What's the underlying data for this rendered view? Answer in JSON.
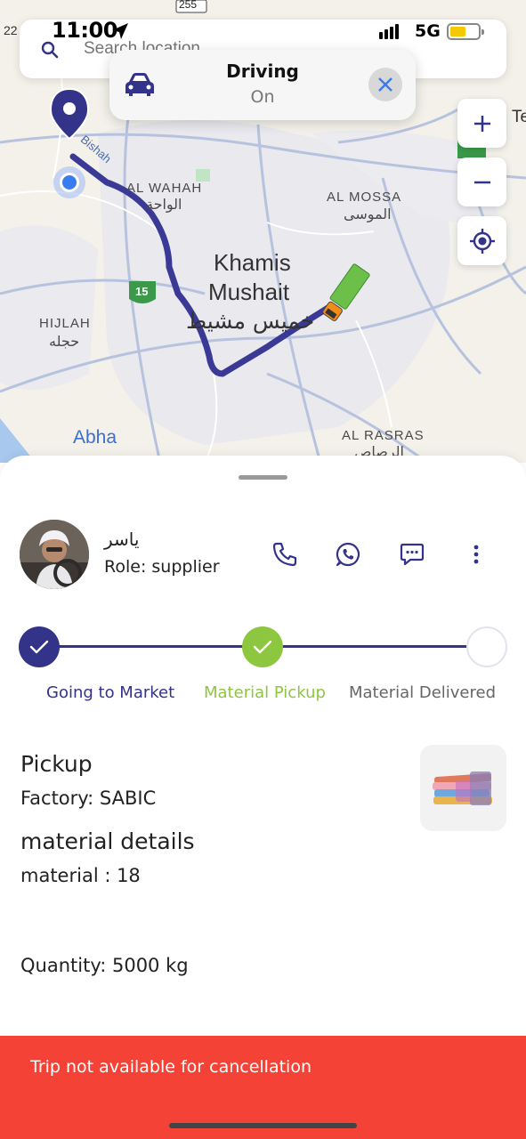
{
  "status_bar": {
    "time": "11:00",
    "network": "5G"
  },
  "search": {
    "placeholder": "Search location"
  },
  "driving": {
    "title": "Driving",
    "status": "On"
  },
  "map": {
    "labels": {
      "al_wahah_en": "AL WAHAH",
      "al_wahah_ar": "الواحة",
      "al_mossa_en": "AL MOSSA",
      "al_mossa_ar": "الموسى",
      "khamis_1": "Khamis",
      "khamis_2": "Mushait",
      "khamis_ar": "خميس مشيط",
      "hijlah_en": "HIJLAH",
      "hijlah_ar": "حجله",
      "abha": "Abha",
      "al_rasras_en": "AL RASRAS",
      "al_rasras_ar": "الرصاص",
      "road_bishah": "Bishah",
      "route_15": "15",
      "route_255": "255",
      "edge_te": "Te",
      "edge_22": "22"
    },
    "route_color": "#3a3a96"
  },
  "driver": {
    "name": "ياسر",
    "role": "Role: supplier"
  },
  "steps": [
    {
      "label": "Going to Market",
      "state": "done"
    },
    {
      "label": "Material Pickup",
      "state": "current"
    },
    {
      "label": "Material Delivered",
      "state": "pending"
    }
  ],
  "details": {
    "pickup_title": "Pickup",
    "factory": "Factory: SABIC",
    "material_title": "material details",
    "material": "material : 18",
    "quantity": "Quantity: 5000 kg"
  },
  "banner": {
    "text": "Trip not available for cancellation"
  },
  "colors": {
    "primary": "#33338a",
    "accent_green": "#8dc63f",
    "banner": "#f44236"
  }
}
